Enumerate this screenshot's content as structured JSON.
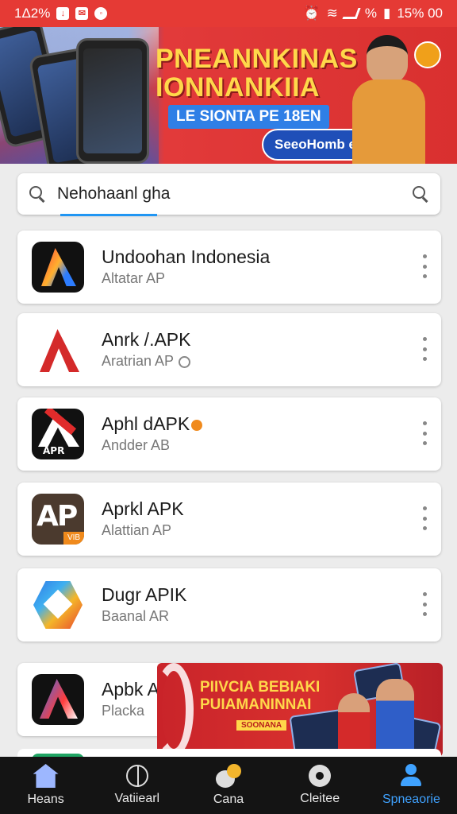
{
  "status_bar": {
    "time": "1Δ2%",
    "right_text": "%",
    "battery": "15% 00",
    "icons": [
      "mail-icon",
      "download-icon",
      "wifi-icon",
      "signal-icon",
      "alarm-icon",
      "battery-icon"
    ]
  },
  "banner": {
    "title_line1": "PNEANNKINAS",
    "title_line2": "IONNANKIIA",
    "subtitle": "LE SIONTA PE 18EN",
    "cta": "SeeoHomb ePIb",
    "colors": {
      "primary": "#e53a35",
      "accent": "#ffd84a",
      "blue": "#2f7fe6"
    }
  },
  "search": {
    "value": "Nehohaanl gha",
    "icons": [
      "search-icon",
      "search-icon"
    ]
  },
  "apps": [
    {
      "title": "Undoohan Indonesia",
      "subtitle": "Altatar AP",
      "icon": "app-logo-a-icon"
    },
    {
      "title": "Anrk /.APK",
      "subtitle": "Aratrian AP",
      "icon": "app-logo-red-a-icon"
    },
    {
      "title": "Aphl dAPK",
      "subtitle": "Andder AB",
      "icon": "app-logo-apr-icon"
    },
    {
      "title": "Aprkl APK",
      "subtitle": "Alattian AP",
      "icon": "app-logo-ap-icon"
    },
    {
      "title": "Dugr APIK",
      "subtitle": "Baanal AR",
      "icon": "app-logo-hex-icon"
    },
    {
      "title": "Apbk A",
      "subtitle": "Placka",
      "icon": "app-logo-gradient-a-icon"
    }
  ],
  "ad": {
    "line1": "PIIVCIA BEBIAKI",
    "line2": "PUIAMANINNAI",
    "line3": "SOONANA"
  },
  "bottom_nav": {
    "items": [
      {
        "label": "Heans",
        "icon": "home-icon",
        "active": false
      },
      {
        "label": "Vatiiearl",
        "icon": "globe-icon",
        "active": false
      },
      {
        "label": "Cana",
        "icon": "game-icon",
        "active": false
      },
      {
        "label": "Cleitee",
        "icon": "location-icon",
        "active": false
      },
      {
        "label": "Spneaorie",
        "icon": "profile-icon",
        "active": true
      }
    ],
    "active_color": "#3fa2ff"
  }
}
